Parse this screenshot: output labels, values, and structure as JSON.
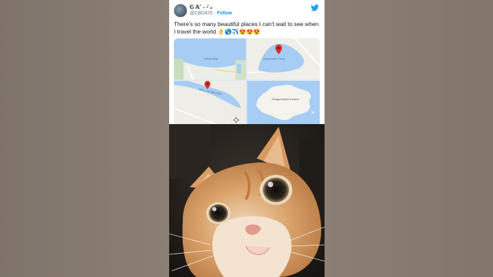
{
  "tweet": {
    "display_name": "𝔾 𝔸˚ - ᵕ̈ ₉",
    "handle": "@CBD420",
    "separator": "·",
    "follow_label": "Follow",
    "text": "There's so many beautiful places I can't wait to see when I travel the world 👌🌎✈️😍😍😍"
  },
  "maps": [
    {
      "label": "Misery Bay"
    },
    {
      "label": "Depression Pond"
    },
    {
      "label": "Bad Luck Mountain"
    },
    {
      "label": "Disappointment Island"
    }
  ],
  "colors": {
    "twitter_blue": "#1da1f2",
    "follow_blue": "#1b95e0",
    "water": "#a7cdf4",
    "pin_red": "#d93025"
  },
  "icons": [
    "twitter-bird-icon",
    "map-pin-icon",
    "location-target-icon"
  ]
}
